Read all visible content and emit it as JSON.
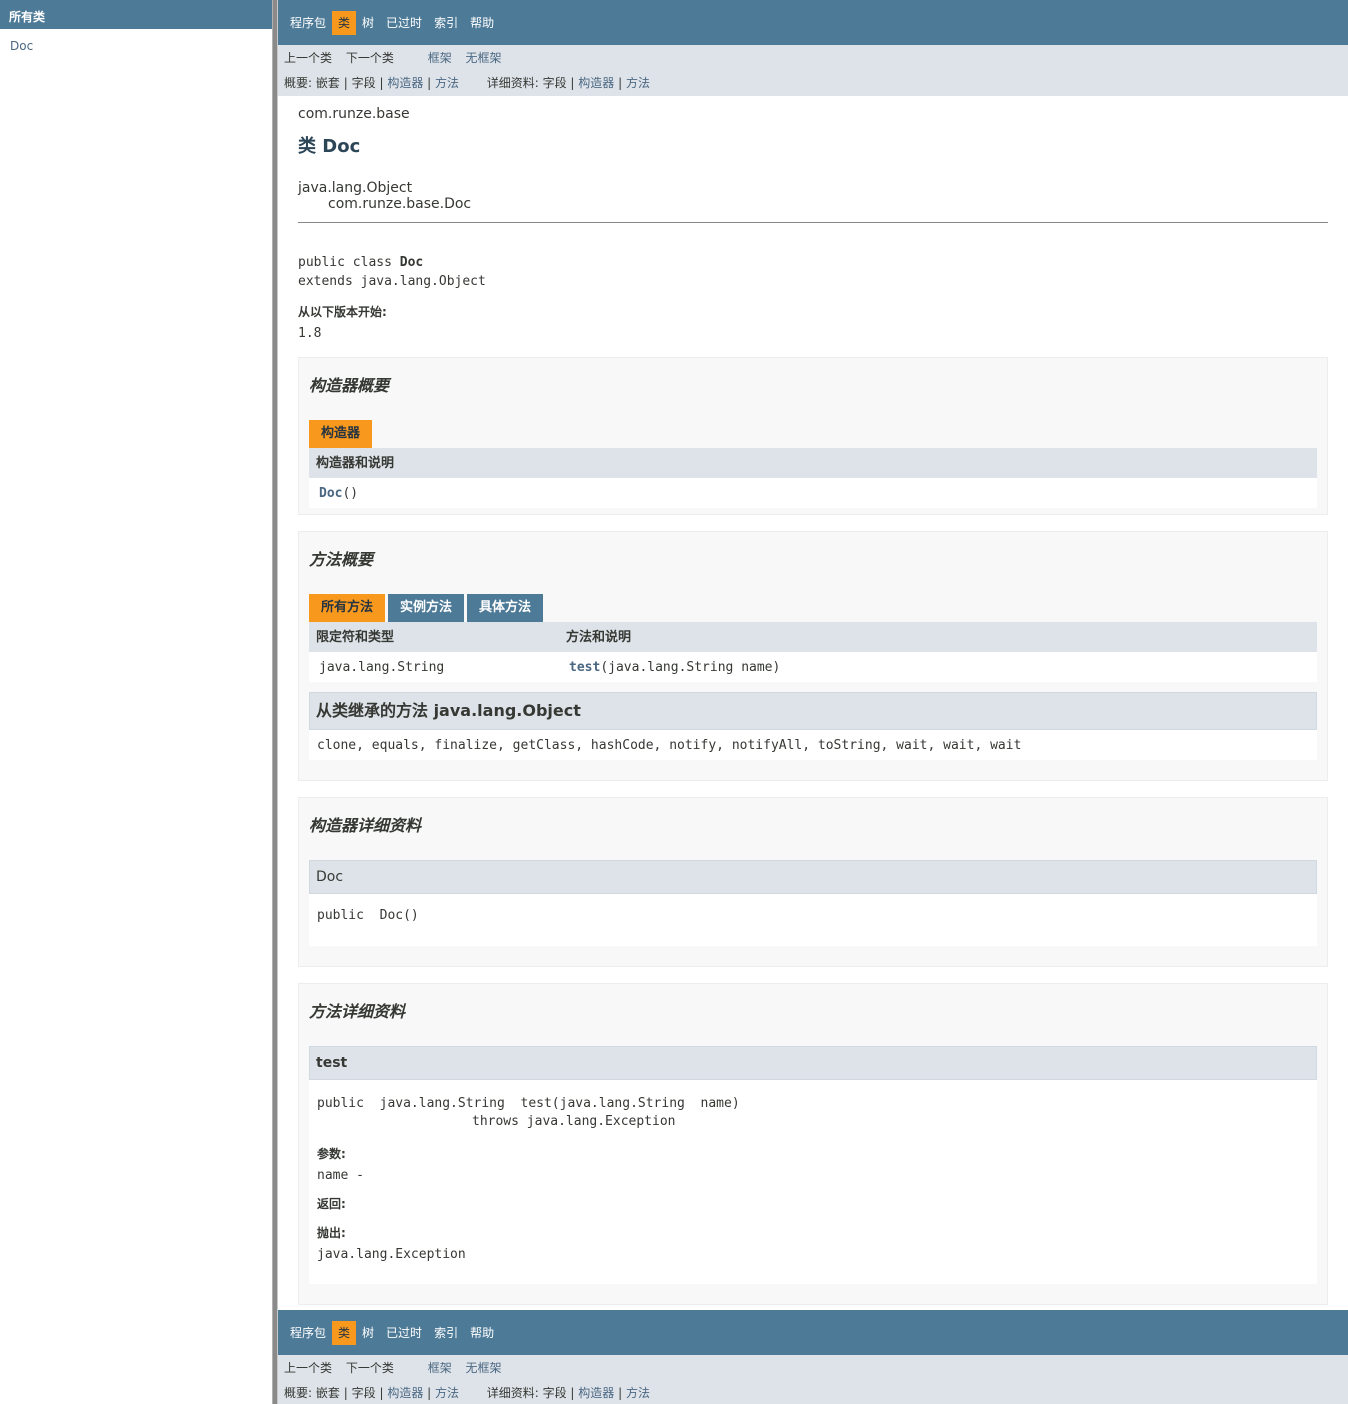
{
  "left": {
    "header": "所有类",
    "classes": [
      "Doc"
    ]
  },
  "topnav": {
    "items": [
      "程序包",
      "类",
      "树",
      "已过时",
      "索引",
      "帮助"
    ],
    "active": "类"
  },
  "subnav": {
    "prev_class": "上一个类",
    "next_class": "下一个类",
    "frames": "框架",
    "no_frames": "无框架",
    "summary_label": "概要:",
    "summary_nested": "嵌套",
    "summary_field": "字段",
    "summary_constructor": "构造器",
    "summary_method": "方法",
    "detail_label": "详细资料:",
    "detail_field": "字段",
    "detail_constructor": "构造器",
    "detail_method": "方法",
    "sep": "|"
  },
  "header": {
    "package": "com.runze.base",
    "title": "类 Doc"
  },
  "inheritance": {
    "parent": "java.lang.Object",
    "child": "com.runze.base.Doc"
  },
  "declaration": {
    "line1_prefix": "public class ",
    "line1_name": "Doc",
    "line2": "extends java.lang.Object"
  },
  "since": {
    "label": "从以下版本开始:",
    "value": "1.8"
  },
  "constructor_summary": {
    "heading": "构造器概要",
    "tab": "构造器",
    "column": "构造器和说明",
    "row_name": "Doc",
    "row_suffix": "()"
  },
  "method_summary": {
    "heading": "方法概要",
    "tabs": [
      "所有方法",
      "实例方法",
      "具体方法"
    ],
    "columns": [
      "限定符和类型",
      "方法和说明"
    ],
    "row": {
      "type": "java.lang.String",
      "name": "test",
      "params": "(java.lang.String  name)"
    },
    "inherited_heading": "从类继承的方法 java.lang.Object",
    "inherited_methods": "clone, equals, finalize, getClass, hashCode, notify, notifyAll, toString, wait, wait, wait"
  },
  "constructor_detail": {
    "heading": "构造器详细资料",
    "name": "Doc",
    "signature": "public  Doc()"
  },
  "method_detail": {
    "heading": "方法详细资料",
    "name": "test",
    "signature_line1": "public  java.lang.String  test(java.lang.String  name)",
    "signature_line2": "throws java.lang.Exception",
    "params_label": "参数:",
    "params_value": "name -",
    "returns_label": "返回:",
    "throws_label": "抛出:",
    "throws_value": "java.lang.Exception"
  },
  "colors": {
    "nav_bg": "#4d7a97",
    "active_tab": "#f8981d",
    "subnav_bg": "#dee3e9",
    "link": "#4a6782"
  }
}
